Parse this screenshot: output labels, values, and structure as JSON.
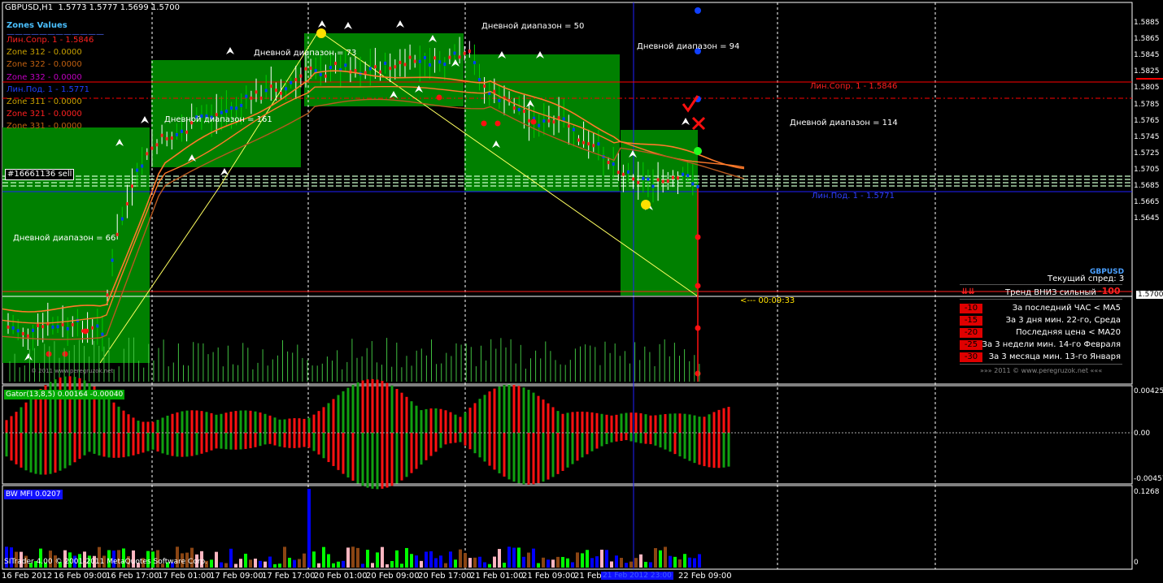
{
  "header": {
    "symbol_tf": "GBPUSD,H1",
    "ohlc": "1.5773 1.5777 1.5699 1.5700"
  },
  "zones_panel": {
    "title": "Zones Values",
    "items": [
      {
        "label": "Лин.Сопр. 1     - 1.5846",
        "color": "#ff2020"
      },
      {
        "label": "Zone 312 - 0.0000",
        "color": "#c8a000"
      },
      {
        "label": "Zone 322 - 0.0000",
        "color": "#c06010"
      },
      {
        "label": "Zone 332 - 0.0000",
        "color": "#c000c0"
      },
      {
        "label": "Лин.Под. 1     - 1.5771",
        "color": "#2040ff"
      },
      {
        "label": "Zone 311 - 0.0000",
        "color": "#c8a000"
      },
      {
        "label": "Zone 321 - 0.0000",
        "color": "#ff2020"
      },
      {
        "label": "Zone 331 - 0.0000",
        "color": "#c06010"
      }
    ]
  },
  "order_label": "#16661136 sell",
  "daily_ranges": [
    {
      "label": "Дневной диапазон = 66"
    },
    {
      "label": "Дневной диапазон = 161"
    },
    {
      "label": "Дневной диапазон = 73"
    },
    {
      "label": "Дневной диапазон = 50"
    },
    {
      "label": "Дневной диапазон = 94"
    },
    {
      "label": "Дневной диапазон = 114"
    }
  ],
  "level_labels": {
    "resistance": "Лин.Сопр. 1 - 1.5846",
    "support": "Лин.Под. 1 - 1.5771"
  },
  "timer": "<--- 00:09:33",
  "info_panel": {
    "symbol": "GBPUSD",
    "spread": "Текущий спред: 3",
    "trend_label": "Тренд ВНИЗ сильный",
    "trend_value": "-100",
    "rows": [
      {
        "badge": "-10",
        "text": "За последний ЧАС < MA5"
      },
      {
        "badge": "-15",
        "text": "За 3 дня мин. 22-го, Среда"
      },
      {
        "badge": "-20",
        "text": "Последняя цена < MA20"
      },
      {
        "badge": "-25",
        "text": "За 3 недели мин. 14-го Февраля"
      },
      {
        "badge": "-30",
        "text": "За 3 месяца мин. 13-го Января"
      }
    ],
    "footer": "»»»    2011  ©  www.peregruzok.net        «««"
  },
  "price_scale": [
    "1.5885",
    "1.5865",
    "1.5845",
    "1.5825",
    "1.5805",
    "1.5785",
    "1.5765",
    "1.5745",
    "1.5725",
    "1.5705",
    "1.5685",
    "1.5665",
    "1.5645"
  ],
  "price_current": "1.5700",
  "price_resistance_tag": "1.5846",
  "gator": {
    "label": "Gator(13,8,5) 0.00164 -0.00040",
    "scale": [
      "0.00425",
      "0.00",
      "-0.00457"
    ]
  },
  "mfi": {
    "label": "BW MFI 0.0207",
    "scale": [
      "0.1268",
      "0"
    ]
  },
  "copyright": "SITrader 4.00 © 2001-2011 MetaQuotes Software Corp.",
  "watermark": "© 2011  www.peregruzok.net",
  "time_axis": [
    "16 Feb 2012",
    "16 Feb 09:00",
    "16 Feb 17:00",
    "17 Feb 01:00",
    "17 Feb 09:00",
    "17 Feb 17:00",
    "20 Feb 01:00",
    "20 Feb 09:00",
    "20 Feb 17:00",
    "21 Feb 01:00",
    "21 Feb 09:00",
    "21 Feb",
    "22 Feb 09:00"
  ],
  "time_axis_highlight": "21 Feb 2012 23:00",
  "colors": {
    "zone_green": "#008000",
    "ma_orange": "#ff7a2a",
    "ma_brown": "#b85a20",
    "resistance_red": "#ff0000",
    "support_blue": "#2020ff",
    "trend_yellow": "#ffff60",
    "bull_bar": "#00cc00",
    "bear_bar": "#ff2020"
  }
}
